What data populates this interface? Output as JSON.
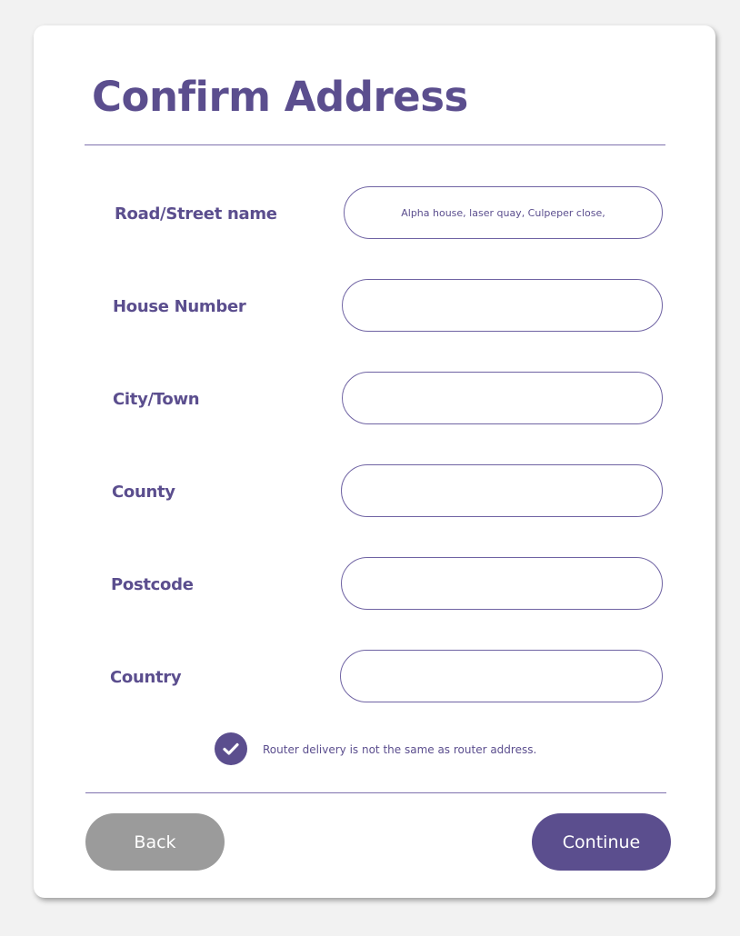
{
  "title": "Confirm Address",
  "fields": [
    {
      "label": "Road/Street name",
      "value": "Alpha house, laser quay, Culpeper close,"
    },
    {
      "label": "House Number",
      "value": ""
    },
    {
      "label": "City/Town",
      "value": ""
    },
    {
      "label": "County",
      "value": ""
    },
    {
      "label": "Postcode",
      "value": ""
    },
    {
      "label": "Country",
      "value": ""
    }
  ],
  "checkbox": {
    "checked": true,
    "label": "Router delivery is not the same as router address."
  },
  "buttons": {
    "back": "Back",
    "continue": "Continue"
  },
  "colors": {
    "primary": "#5b4e8e",
    "secondary_button": "#9b9b9b",
    "background": "#f2f2f2",
    "card": "#ffffff"
  },
  "icons": {
    "checkbox": "check-icon"
  }
}
